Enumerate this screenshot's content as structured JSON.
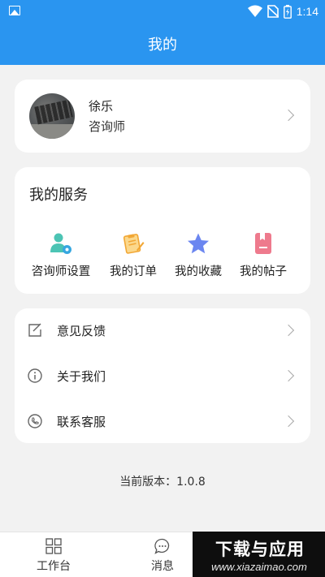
{
  "status_bar": {
    "time": "1:14"
  },
  "header": {
    "title": "我的"
  },
  "profile": {
    "name": "徐乐",
    "role": "咨询师"
  },
  "services": {
    "title": "我的服务",
    "items": [
      {
        "label": "咨询师设置",
        "icon": "counselor-settings-icon",
        "color": "#4cc4b4"
      },
      {
        "label": "我的订单",
        "icon": "order-icon",
        "color": "#f2a735"
      },
      {
        "label": "我的收藏",
        "icon": "star-icon",
        "color": "#6b86f0"
      },
      {
        "label": "我的帖子",
        "icon": "post-icon",
        "color": "#ee7a8d"
      }
    ]
  },
  "menu": {
    "items": [
      {
        "label": "意见反馈",
        "icon": "feedback-icon"
      },
      {
        "label": "关于我们",
        "icon": "info-icon"
      },
      {
        "label": "联系客服",
        "icon": "phone-icon"
      }
    ]
  },
  "version": "当前版本：1.0.8",
  "tabbar": {
    "items": [
      {
        "label": "工作台",
        "icon": "grid-icon"
      },
      {
        "label": "消息",
        "icon": "message-icon"
      }
    ]
  },
  "watermark": {
    "text": "下载与应用",
    "url": "www.xiazaimao.com"
  },
  "colors": {
    "primary": "#2a95f0",
    "background": "#f2f2f2"
  }
}
